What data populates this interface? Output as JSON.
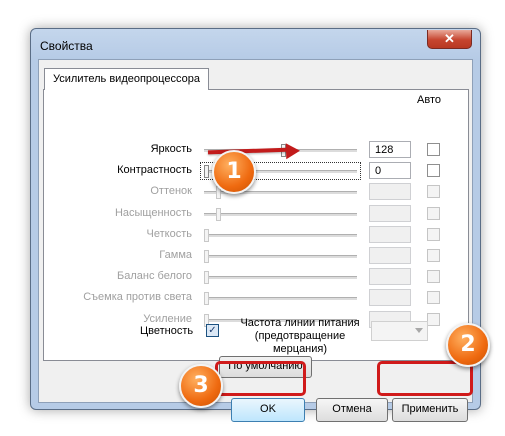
{
  "window": {
    "title": "Свойства",
    "close_glyph": "✕"
  },
  "tab": {
    "label": "Усилитель видеопроцессора"
  },
  "auto_header": "Авто",
  "properties": [
    {
      "label": "Яркость",
      "value": "128",
      "enabled": true,
      "slider_fraction": 0.5,
      "auto": false
    },
    {
      "label": "Контрастность",
      "value": "0",
      "enabled": true,
      "slider_fraction": 0.0,
      "auto": false,
      "focused": true
    },
    {
      "label": "Оттенок",
      "value": "",
      "enabled": false,
      "slider_fraction": 0.08,
      "auto": false
    },
    {
      "label": "Насыщенность",
      "value": "",
      "enabled": false,
      "slider_fraction": 0.08,
      "auto": false
    },
    {
      "label": "Четкость",
      "value": "",
      "enabled": false,
      "slider_fraction": 0.0,
      "auto": false
    },
    {
      "label": "Гамма",
      "value": "",
      "enabled": false,
      "slider_fraction": 0.0,
      "auto": false
    },
    {
      "label": "Баланс белого",
      "value": "",
      "enabled": false,
      "slider_fraction": 0.0,
      "auto": false
    },
    {
      "label": "Съемка против света",
      "value": "",
      "enabled": false,
      "slider_fraction": 0.0,
      "auto": false
    },
    {
      "label": "Усиление",
      "value": "",
      "enabled": false,
      "slider_fraction": 0.0,
      "auto": false
    }
  ],
  "color": {
    "label": "Цветность",
    "checked": true,
    "check_glyph": "✓"
  },
  "power_line": {
    "label_lines": [
      "Частота линии питания",
      "(предотвращение",
      "мерцания)"
    ],
    "value": ""
  },
  "buttons": {
    "default": "По умолчанию",
    "ok": "OK",
    "cancel": "Отмена",
    "apply": "Применить"
  },
  "annotations": {
    "badge_1": "1",
    "badge_2": "2",
    "badge_3": "3",
    "color": "#d01a1a",
    "badge_color": "#ef6a10"
  }
}
